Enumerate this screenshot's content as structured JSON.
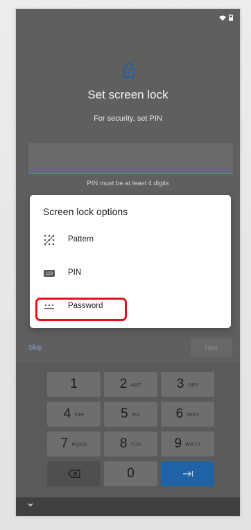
{
  "screen": {
    "title": "Set screen lock",
    "subtitle": "For security, set PIN",
    "pin_hint": "PIN must be at least 4 digits",
    "skip_label": "Skip",
    "next_label": "Next"
  },
  "dialog": {
    "title": "Screen lock options",
    "options": [
      {
        "label": "Pattern",
        "icon": "pattern-icon"
      },
      {
        "label": "PIN",
        "icon": "pin-keypad-icon",
        "icon_text": "123"
      },
      {
        "label": "Password",
        "icon": "password-icon",
        "highlighted": true
      }
    ]
  },
  "keypad": {
    "keys": [
      {
        "digit": "1",
        "letters": ""
      },
      {
        "digit": "2",
        "letters": "ABC"
      },
      {
        "digit": "3",
        "letters": "DEF"
      },
      {
        "digit": "4",
        "letters": "GHI"
      },
      {
        "digit": "5",
        "letters": "JKL"
      },
      {
        "digit": "6",
        "letters": "MNO"
      },
      {
        "digit": "7",
        "letters": "PQRS"
      },
      {
        "digit": "8",
        "letters": "TUV"
      },
      {
        "digit": "9",
        "letters": "WXYZ"
      },
      {
        "digit": "0",
        "letters": ""
      }
    ],
    "backspace_icon": "backspace-icon",
    "enter_icon": "next-field-arrow-icon"
  },
  "colors": {
    "accent": "#2062a6",
    "highlight": "#e4121b"
  }
}
